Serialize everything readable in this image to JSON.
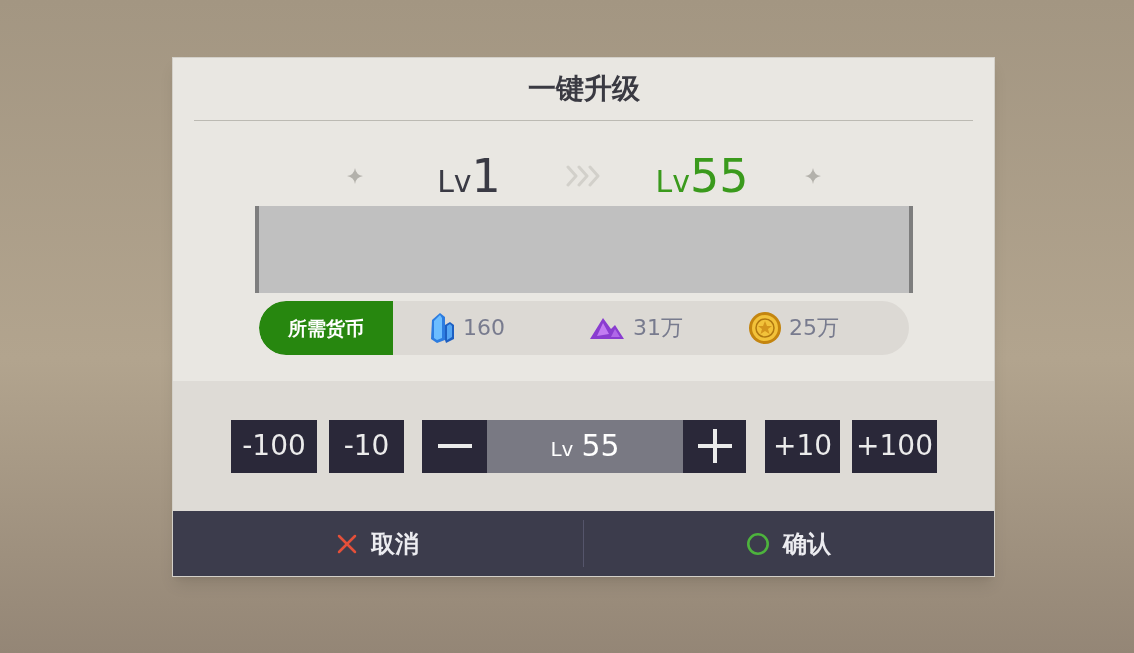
{
  "dialog": {
    "title": "一键升级",
    "level_change": {
      "from": {
        "prefix": "Lv",
        "value": "1"
      },
      "to": {
        "prefix": "Lv",
        "value": "55"
      }
    },
    "required_currency": {
      "label": "所需货币",
      "items": [
        {
          "kind": "crystal",
          "amount": "160"
        },
        {
          "kind": "gem",
          "amount": "31万"
        },
        {
          "kind": "coin",
          "amount": "25万"
        }
      ]
    },
    "level_stepper": {
      "decrease_steps": [
        "-100",
        "-10"
      ],
      "value": {
        "prefix": "Lv",
        "value": "55"
      },
      "increase_steps": [
        "+10",
        "+100"
      ]
    },
    "actions": [
      {
        "kind": "cancel",
        "label": "取消"
      },
      {
        "kind": "confirm",
        "label": "确认"
      }
    ]
  }
}
